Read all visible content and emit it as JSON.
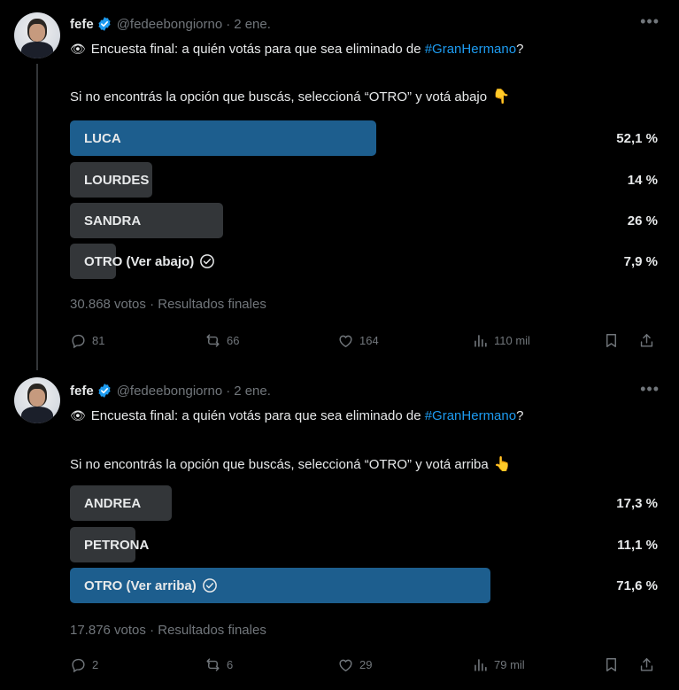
{
  "tweets": [
    {
      "name": "fefe",
      "handle": "@fedeebongiorno",
      "date": "2 ene.",
      "line1_text": "Encuesta final: a quién votás para que sea eliminado de ",
      "hashtag": "#GranHermano",
      "line1_end": "?",
      "line2_text": "Si no encontrás la opción que buscás, seleccioná “OTRO” y votá abajo",
      "hand_emoji": "👇",
      "poll": [
        {
          "label": "LUCA",
          "pct": "52,1 %",
          "value": 52.1,
          "winner": true,
          "checked": false
        },
        {
          "label": "LOURDES",
          "pct": "14 %",
          "value": 14,
          "winner": false,
          "checked": false
        },
        {
          "label": "SANDRA",
          "pct": "26 %",
          "value": 26,
          "winner": false,
          "checked": false
        },
        {
          "label": "OTRO (Ver abajo)",
          "pct": "7,9 %",
          "value": 7.9,
          "winner": false,
          "checked": true
        }
      ],
      "votes": "30.868 votos",
      "status": "Resultados finales",
      "replies": "81",
      "reposts": "66",
      "likes": "164",
      "views": "110 mil"
    },
    {
      "name": "fefe",
      "handle": "@fedeebongiorno",
      "date": "2 ene.",
      "line1_text": "Encuesta final: a quién votás para que sea eliminado de ",
      "hashtag": "#GranHermano",
      "line1_end": "?",
      "line2_text": "Si no encontrás la opción que buscás, seleccioná “OTRO” y votá arriba",
      "hand_emoji": "👆",
      "poll": [
        {
          "label": "ANDREA",
          "pct": "17,3 %",
          "value": 17.3,
          "winner": false,
          "checked": false
        },
        {
          "label": "PETRONA",
          "pct": "11,1 %",
          "value": 11.1,
          "winner": false,
          "checked": false
        },
        {
          "label": "OTRO (Ver arriba)",
          "pct": "71,6 %",
          "value": 71.6,
          "winner": true,
          "checked": true
        }
      ],
      "votes": "17.876 votos",
      "status": "Resultados finales",
      "replies": "2",
      "reposts": "6",
      "likes": "29",
      "views": "79 mil"
    }
  ],
  "icons": {
    "eye": "eye-icon",
    "verified": "verified-badge-icon",
    "more": "more-options-icon",
    "reply": "reply-icon",
    "repost": "repost-icon",
    "like": "like-icon",
    "views": "views-icon",
    "bookmark": "bookmark-icon",
    "share": "share-icon"
  },
  "colors": {
    "background": "#000000",
    "text": "#e7e9ea",
    "muted": "#71767b",
    "accent": "#1d9bf0",
    "poll_winner": "#1d5e8e",
    "poll_other": "#333639"
  }
}
